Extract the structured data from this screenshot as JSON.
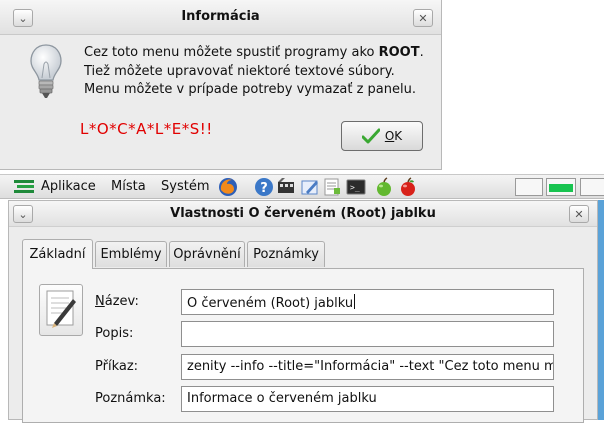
{
  "info_dialog": {
    "title": "Informácia",
    "message_lines": [
      {
        "pre": "Cez toto menu môžete spustiť programy ako ",
        "bold": "ROOT",
        "post": "."
      },
      {
        "pre": "Tiež môžete upravovať niektoré textové súbory.",
        "bold": "",
        "post": ""
      },
      {
        "pre": "Menu môžete v prípade potreby vymazať z panelu.",
        "bold": "",
        "post": ""
      }
    ],
    "highlight_text": "L*O*C*A*L*E*S!!",
    "ok_button": {
      "mnemonic": "O",
      "rest": "K"
    },
    "icon": "lightbulb-icon",
    "highlight_color": "#e10000"
  },
  "panel": {
    "menus": [
      "Aplikace",
      "Místa",
      "Systém"
    ],
    "launchers": [
      "firefox-icon",
      "help-icon",
      "video-icon",
      "edit-icon",
      "text-editor-icon",
      "terminal-icon",
      "green-apple-icon",
      "red-apple-icon"
    ],
    "workspace_active_color": "#18c450"
  },
  "properties_dialog": {
    "title": "Vlastnosti O červeném (Root) jablku",
    "tabs": [
      "Základní",
      "Emblémy",
      "Oprávnění",
      "Poznámky"
    ],
    "active_tab": "Základní",
    "fields": {
      "name": {
        "label_mnemonic": "N",
        "label_rest": "ázev:",
        "value": "O červeném (Root) jablku"
      },
      "description": {
        "label": "Popis:",
        "value": ""
      },
      "command": {
        "label": "Příkaz:",
        "value": "zenity --info --title=\"Informácia\" --text \"Cez toto menu m"
      },
      "note": {
        "label": "Poznámka:",
        "value": "Informace o červeném jablku"
      }
    }
  }
}
